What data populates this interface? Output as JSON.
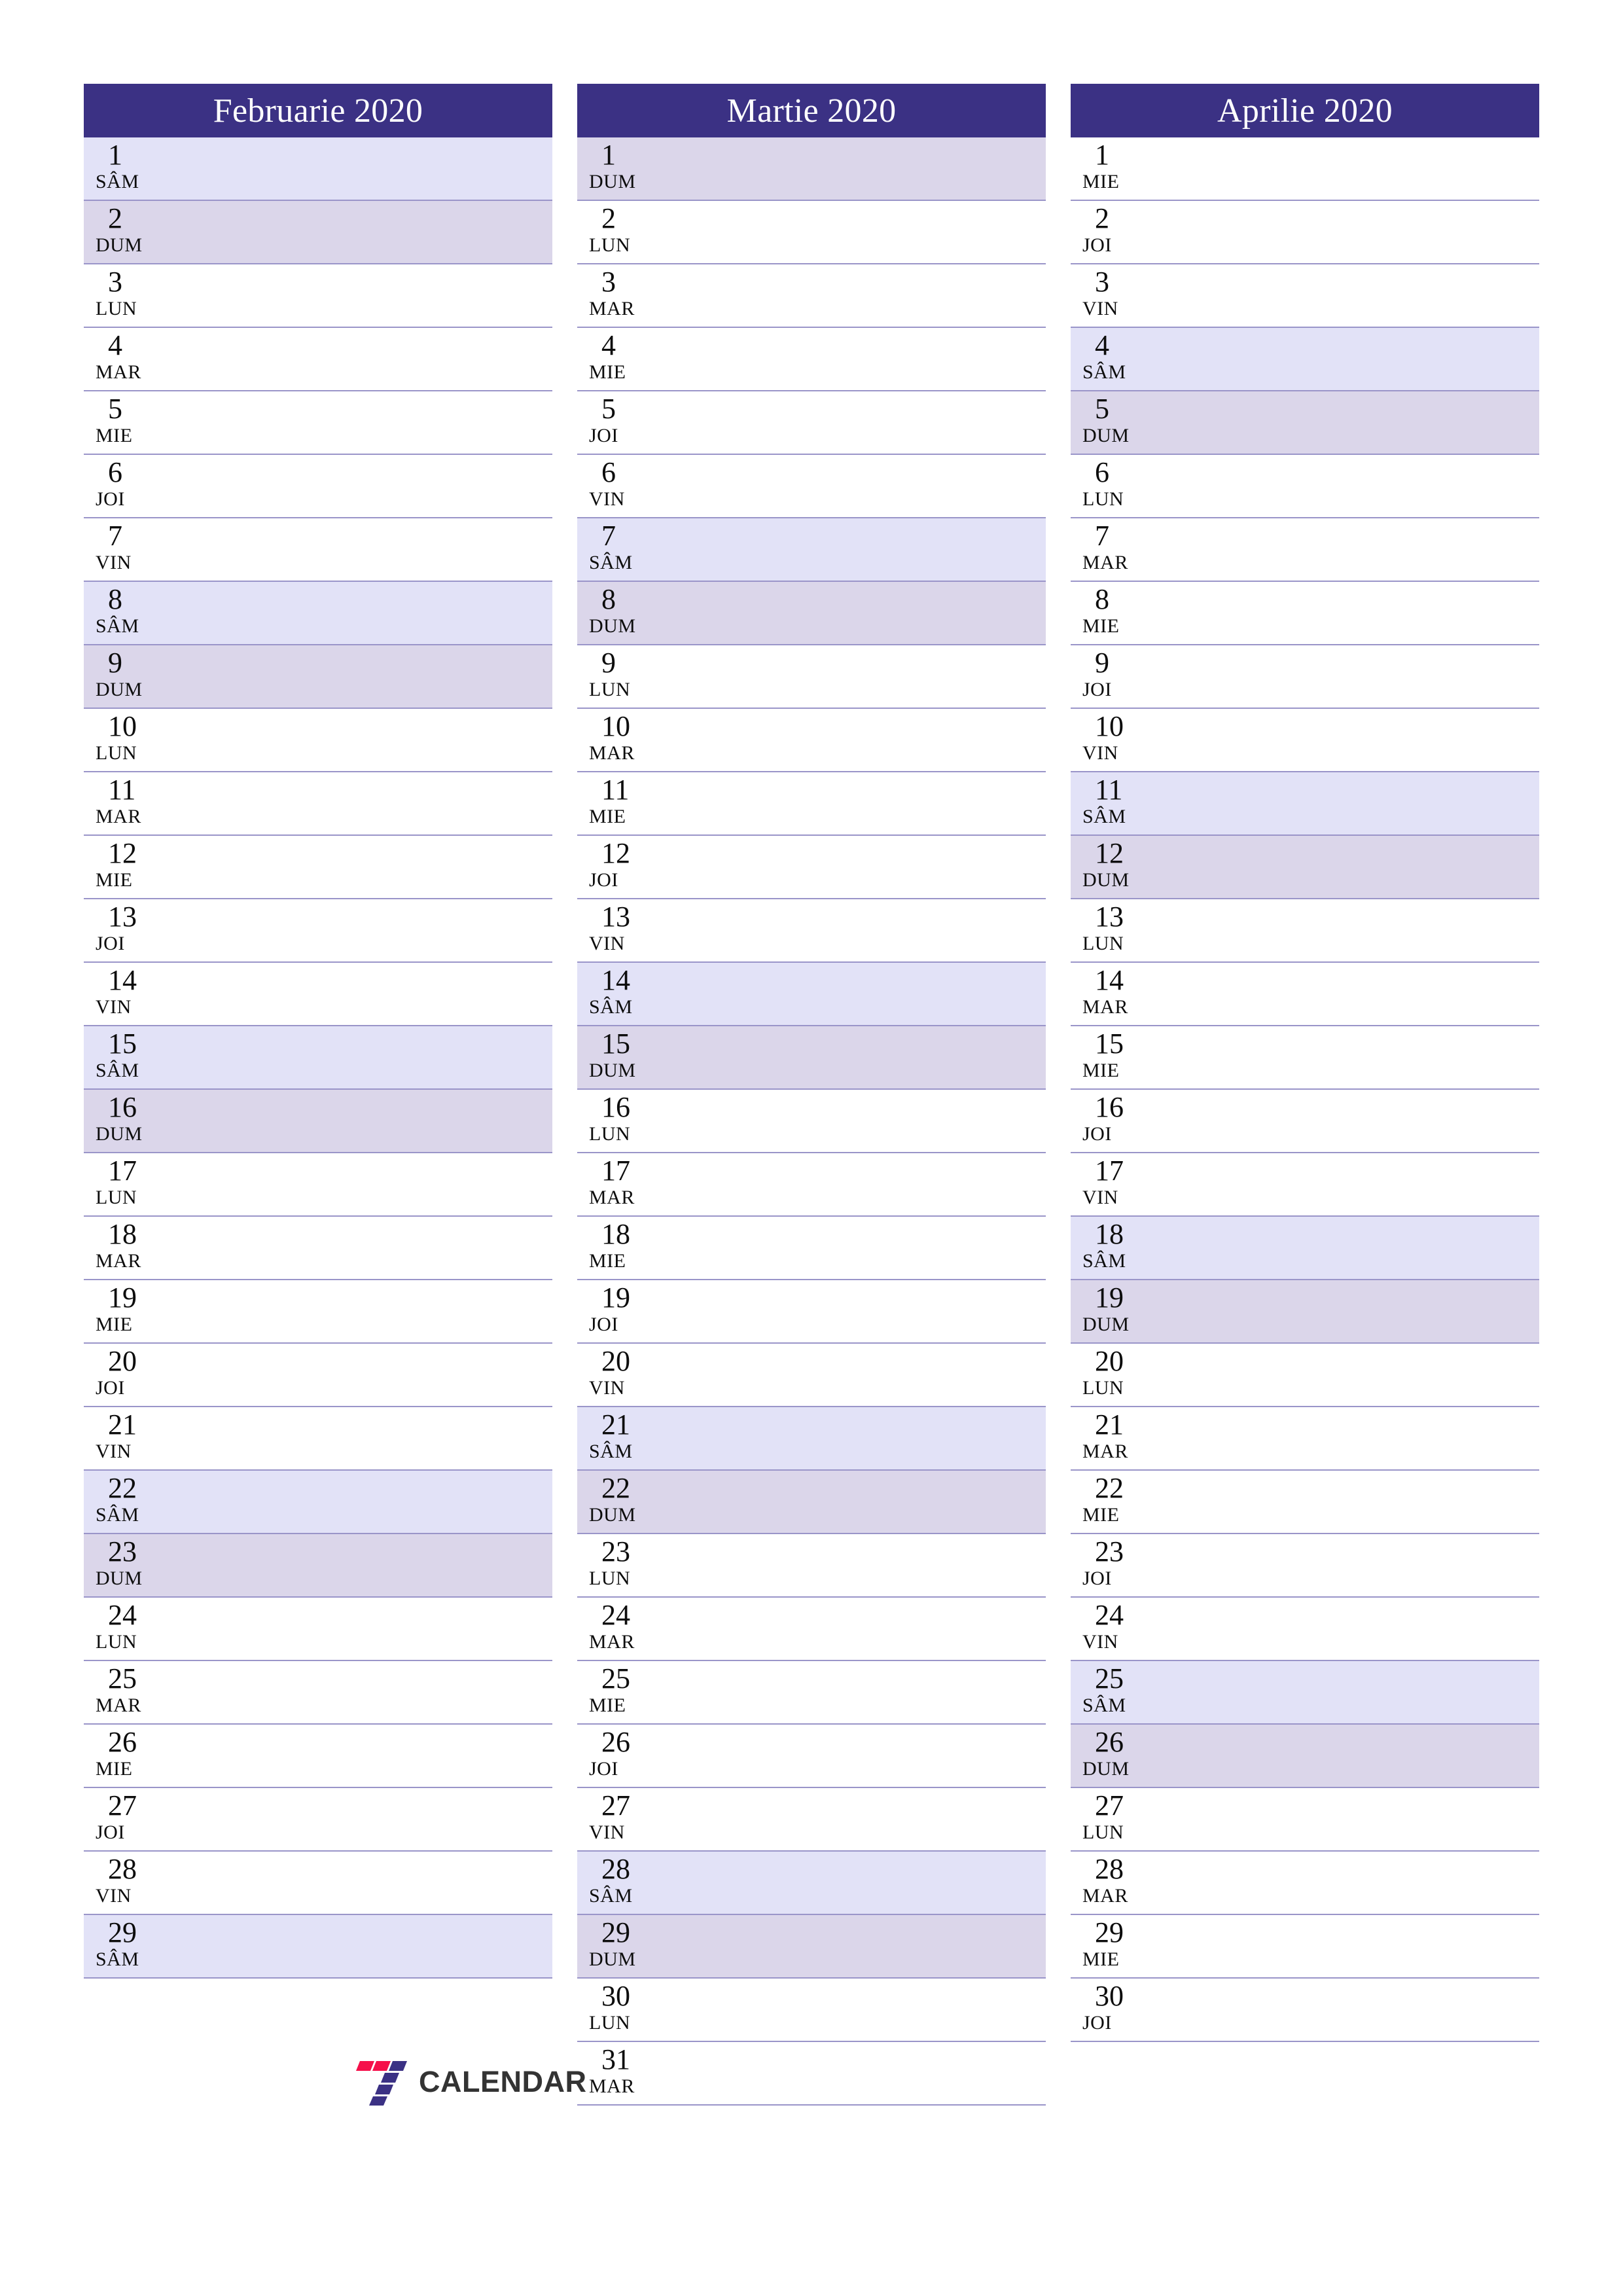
{
  "document": {
    "type": "calendar-planner",
    "year": "2020",
    "language": "ro",
    "page_size": "A4-portrait"
  },
  "colors": {
    "header_bg": "#3b3184",
    "header_text": "#ffffff",
    "saturday_bg": "#e2e2f7",
    "sunday_bg": "#dbd6ea",
    "row_border": "#9a95c9",
    "day_text": "#0d0d0d",
    "logo_red": "#f5104a",
    "logo_blue": "#3b3184",
    "logo_text": "#333333",
    "page_bg": "#ffffff"
  },
  "weekday_abbr": {
    "mon": "LUN",
    "tue": "MAR",
    "wed": "MIE",
    "thu": "JOI",
    "fri": "VIN",
    "sat": "SÂM",
    "sun": "DUM"
  },
  "months": [
    {
      "title": "Februarie 2020",
      "name": "Februarie",
      "year": "2020",
      "days": [
        {
          "num": "1",
          "abbr": "SÂM",
          "kind": "sat"
        },
        {
          "num": "2",
          "abbr": "DUM",
          "kind": "sun"
        },
        {
          "num": "3",
          "abbr": "LUN",
          "kind": "wd"
        },
        {
          "num": "4",
          "abbr": "MAR",
          "kind": "wd"
        },
        {
          "num": "5",
          "abbr": "MIE",
          "kind": "wd"
        },
        {
          "num": "6",
          "abbr": "JOI",
          "kind": "wd"
        },
        {
          "num": "7",
          "abbr": "VIN",
          "kind": "wd"
        },
        {
          "num": "8",
          "abbr": "SÂM",
          "kind": "sat"
        },
        {
          "num": "9",
          "abbr": "DUM",
          "kind": "sun"
        },
        {
          "num": "10",
          "abbr": "LUN",
          "kind": "wd"
        },
        {
          "num": "11",
          "abbr": "MAR",
          "kind": "wd"
        },
        {
          "num": "12",
          "abbr": "MIE",
          "kind": "wd"
        },
        {
          "num": "13",
          "abbr": "JOI",
          "kind": "wd"
        },
        {
          "num": "14",
          "abbr": "VIN",
          "kind": "wd"
        },
        {
          "num": "15",
          "abbr": "SÂM",
          "kind": "sat"
        },
        {
          "num": "16",
          "abbr": "DUM",
          "kind": "sun"
        },
        {
          "num": "17",
          "abbr": "LUN",
          "kind": "wd"
        },
        {
          "num": "18",
          "abbr": "MAR",
          "kind": "wd"
        },
        {
          "num": "19",
          "abbr": "MIE",
          "kind": "wd"
        },
        {
          "num": "20",
          "abbr": "JOI",
          "kind": "wd"
        },
        {
          "num": "21",
          "abbr": "VIN",
          "kind": "wd"
        },
        {
          "num": "22",
          "abbr": "SÂM",
          "kind": "sat"
        },
        {
          "num": "23",
          "abbr": "DUM",
          "kind": "sun"
        },
        {
          "num": "24",
          "abbr": "LUN",
          "kind": "wd"
        },
        {
          "num": "25",
          "abbr": "MAR",
          "kind": "wd"
        },
        {
          "num": "26",
          "abbr": "MIE",
          "kind": "wd"
        },
        {
          "num": "27",
          "abbr": "JOI",
          "kind": "wd"
        },
        {
          "num": "28",
          "abbr": "VIN",
          "kind": "wd"
        },
        {
          "num": "29",
          "abbr": "SÂM",
          "kind": "sat"
        }
      ]
    },
    {
      "title": "Martie 2020",
      "name": "Martie",
      "year": "2020",
      "days": [
        {
          "num": "1",
          "abbr": "DUM",
          "kind": "sun"
        },
        {
          "num": "2",
          "abbr": "LUN",
          "kind": "wd"
        },
        {
          "num": "3",
          "abbr": "MAR",
          "kind": "wd"
        },
        {
          "num": "4",
          "abbr": "MIE",
          "kind": "wd"
        },
        {
          "num": "5",
          "abbr": "JOI",
          "kind": "wd"
        },
        {
          "num": "6",
          "abbr": "VIN",
          "kind": "wd"
        },
        {
          "num": "7",
          "abbr": "SÂM",
          "kind": "sat"
        },
        {
          "num": "8",
          "abbr": "DUM",
          "kind": "sun"
        },
        {
          "num": "9",
          "abbr": "LUN",
          "kind": "wd"
        },
        {
          "num": "10",
          "abbr": "MAR",
          "kind": "wd"
        },
        {
          "num": "11",
          "abbr": "MIE",
          "kind": "wd"
        },
        {
          "num": "12",
          "abbr": "JOI",
          "kind": "wd"
        },
        {
          "num": "13",
          "abbr": "VIN",
          "kind": "wd"
        },
        {
          "num": "14",
          "abbr": "SÂM",
          "kind": "sat"
        },
        {
          "num": "15",
          "abbr": "DUM",
          "kind": "sun"
        },
        {
          "num": "16",
          "abbr": "LUN",
          "kind": "wd"
        },
        {
          "num": "17",
          "abbr": "MAR",
          "kind": "wd"
        },
        {
          "num": "18",
          "abbr": "MIE",
          "kind": "wd"
        },
        {
          "num": "19",
          "abbr": "JOI",
          "kind": "wd"
        },
        {
          "num": "20",
          "abbr": "VIN",
          "kind": "wd"
        },
        {
          "num": "21",
          "abbr": "SÂM",
          "kind": "sat"
        },
        {
          "num": "22",
          "abbr": "DUM",
          "kind": "sun"
        },
        {
          "num": "23",
          "abbr": "LUN",
          "kind": "wd"
        },
        {
          "num": "24",
          "abbr": "MAR",
          "kind": "wd"
        },
        {
          "num": "25",
          "abbr": "MIE",
          "kind": "wd"
        },
        {
          "num": "26",
          "abbr": "JOI",
          "kind": "wd"
        },
        {
          "num": "27",
          "abbr": "VIN",
          "kind": "wd"
        },
        {
          "num": "28",
          "abbr": "SÂM",
          "kind": "sat"
        },
        {
          "num": "29",
          "abbr": "DUM",
          "kind": "sun"
        },
        {
          "num": "30",
          "abbr": "LUN",
          "kind": "wd"
        },
        {
          "num": "31",
          "abbr": "MAR",
          "kind": "wd"
        }
      ]
    },
    {
      "title": "Aprilie 2020",
      "name": "Aprilie",
      "year": "2020",
      "days": [
        {
          "num": "1",
          "abbr": "MIE",
          "kind": "wd"
        },
        {
          "num": "2",
          "abbr": "JOI",
          "kind": "wd"
        },
        {
          "num": "3",
          "abbr": "VIN",
          "kind": "wd"
        },
        {
          "num": "4",
          "abbr": "SÂM",
          "kind": "sat"
        },
        {
          "num": "5",
          "abbr": "DUM",
          "kind": "sun"
        },
        {
          "num": "6",
          "abbr": "LUN",
          "kind": "wd"
        },
        {
          "num": "7",
          "abbr": "MAR",
          "kind": "wd"
        },
        {
          "num": "8",
          "abbr": "MIE",
          "kind": "wd"
        },
        {
          "num": "9",
          "abbr": "JOI",
          "kind": "wd"
        },
        {
          "num": "10",
          "abbr": "VIN",
          "kind": "wd"
        },
        {
          "num": "11",
          "abbr": "SÂM",
          "kind": "sat"
        },
        {
          "num": "12",
          "abbr": "DUM",
          "kind": "sun"
        },
        {
          "num": "13",
          "abbr": "LUN",
          "kind": "wd"
        },
        {
          "num": "14",
          "abbr": "MAR",
          "kind": "wd"
        },
        {
          "num": "15",
          "abbr": "MIE",
          "kind": "wd"
        },
        {
          "num": "16",
          "abbr": "JOI",
          "kind": "wd"
        },
        {
          "num": "17",
          "abbr": "VIN",
          "kind": "wd"
        },
        {
          "num": "18",
          "abbr": "SÂM",
          "kind": "sat"
        },
        {
          "num": "19",
          "abbr": "DUM",
          "kind": "sun"
        },
        {
          "num": "20",
          "abbr": "LUN",
          "kind": "wd"
        },
        {
          "num": "21",
          "abbr": "MAR",
          "kind": "wd"
        },
        {
          "num": "22",
          "abbr": "MIE",
          "kind": "wd"
        },
        {
          "num": "23",
          "abbr": "JOI",
          "kind": "wd"
        },
        {
          "num": "24",
          "abbr": "VIN",
          "kind": "wd"
        },
        {
          "num": "25",
          "abbr": "SÂM",
          "kind": "sat"
        },
        {
          "num": "26",
          "abbr": "DUM",
          "kind": "sun"
        },
        {
          "num": "27",
          "abbr": "LUN",
          "kind": "wd"
        },
        {
          "num": "28",
          "abbr": "MAR",
          "kind": "wd"
        },
        {
          "num": "29",
          "abbr": "MIE",
          "kind": "wd"
        },
        {
          "num": "30",
          "abbr": "JOI",
          "kind": "wd"
        }
      ]
    }
  ],
  "logo": {
    "wordmark": "CALENDAR",
    "mark": "seven-logo-icon"
  }
}
